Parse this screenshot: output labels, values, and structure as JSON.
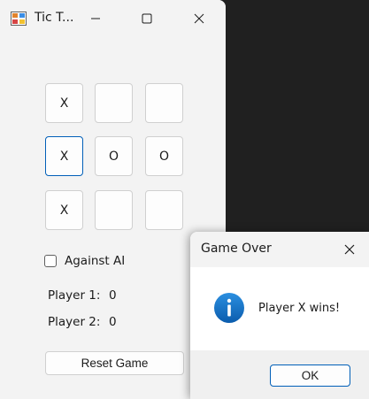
{
  "window": {
    "title": "Tic T...",
    "minimize_icon": "minimize-icon",
    "maximize_icon": "maximize-icon",
    "close_icon": "close-icon"
  },
  "board": {
    "cells": [
      "X",
      "",
      "",
      "X",
      "O",
      "O",
      "X",
      "",
      ""
    ],
    "focused_cell": 3
  },
  "options": {
    "against_ai_label": "Against AI",
    "against_ai_checked": false
  },
  "scores": {
    "player1_label": "Player 1:",
    "player1_score": "0",
    "player2_label": "Player 2:",
    "player2_score": "0"
  },
  "reset_label": "Reset Game",
  "dialog": {
    "title": "Game Over",
    "message": "Player X wins!",
    "ok_label": "OK",
    "icon": "info-icon",
    "accent_color": "#005fb8"
  }
}
